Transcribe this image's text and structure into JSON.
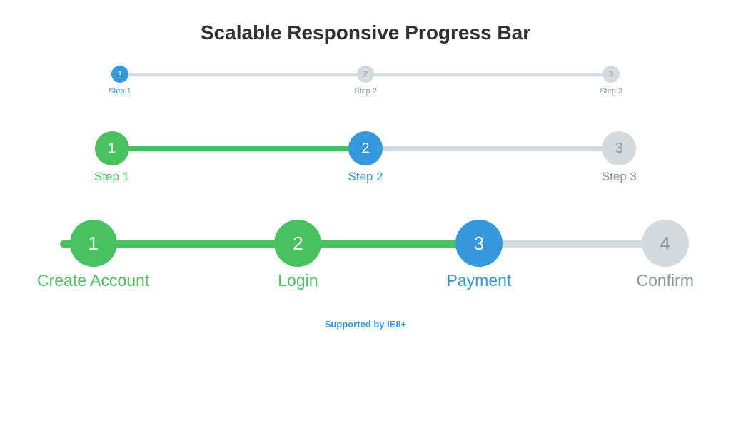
{
  "title": "Scalable Responsive Progress Bar",
  "bars": {
    "small": {
      "steps": [
        {
          "num": "1",
          "label": "Step 1",
          "state": "active"
        },
        {
          "num": "2",
          "label": "Step 2",
          "state": "todo"
        },
        {
          "num": "3",
          "label": "Step 3",
          "state": "todo"
        }
      ]
    },
    "medium": {
      "steps": [
        {
          "num": "1",
          "label": "Step 1",
          "state": "done"
        },
        {
          "num": "2",
          "label": "Step 2",
          "state": "active"
        },
        {
          "num": "3",
          "label": "Step 3",
          "state": "todo"
        }
      ]
    },
    "large": {
      "steps": [
        {
          "num": "1",
          "label": "Create Account",
          "state": "done"
        },
        {
          "num": "2",
          "label": "Login",
          "state": "done"
        },
        {
          "num": "3",
          "label": "Payment",
          "state": "active"
        },
        {
          "num": "4",
          "label": "Confirm",
          "state": "todo"
        }
      ]
    }
  },
  "footer": "Supported by IE8+",
  "colors": {
    "done": "#48c15e",
    "active": "#3498db",
    "todo_bg": "#d3dbde",
    "todo_text": "#8b959a"
  }
}
